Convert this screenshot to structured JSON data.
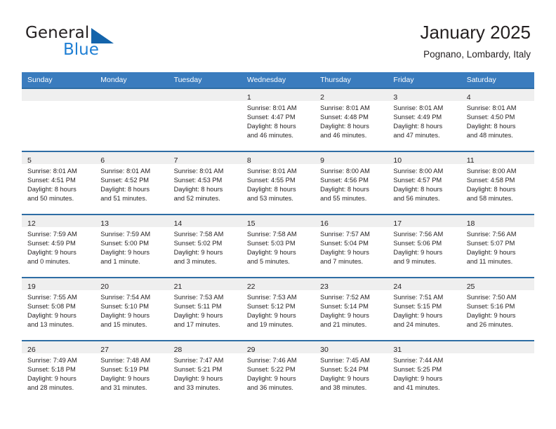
{
  "brand": {
    "name_part1": "General",
    "name_part2": "Blue",
    "logo_icon": "triangle-logo-icon"
  },
  "header": {
    "title": "January 2025",
    "subtitle": "Pognano, Lombardy, Italy"
  },
  "calendar": {
    "weekday_headers": [
      "Sunday",
      "Monday",
      "Tuesday",
      "Wednesday",
      "Thursday",
      "Friday",
      "Saturday"
    ],
    "header_bg": "#3a7cbe",
    "row_border": "#2e6da4",
    "date_band_bg": "#efefef",
    "weeks": [
      [
        {
          "empty": true
        },
        {
          "empty": true
        },
        {
          "empty": true
        },
        {
          "day": "1",
          "sunrise": "Sunrise: 8:01 AM",
          "sunset": "Sunset: 4:47 PM",
          "daylight1": "Daylight: 8 hours",
          "daylight2": "and 46 minutes."
        },
        {
          "day": "2",
          "sunrise": "Sunrise: 8:01 AM",
          "sunset": "Sunset: 4:48 PM",
          "daylight1": "Daylight: 8 hours",
          "daylight2": "and 46 minutes."
        },
        {
          "day": "3",
          "sunrise": "Sunrise: 8:01 AM",
          "sunset": "Sunset: 4:49 PM",
          "daylight1": "Daylight: 8 hours",
          "daylight2": "and 47 minutes."
        },
        {
          "day": "4",
          "sunrise": "Sunrise: 8:01 AM",
          "sunset": "Sunset: 4:50 PM",
          "daylight1": "Daylight: 8 hours",
          "daylight2": "and 48 minutes."
        }
      ],
      [
        {
          "day": "5",
          "sunrise": "Sunrise: 8:01 AM",
          "sunset": "Sunset: 4:51 PM",
          "daylight1": "Daylight: 8 hours",
          "daylight2": "and 50 minutes."
        },
        {
          "day": "6",
          "sunrise": "Sunrise: 8:01 AM",
          "sunset": "Sunset: 4:52 PM",
          "daylight1": "Daylight: 8 hours",
          "daylight2": "and 51 minutes."
        },
        {
          "day": "7",
          "sunrise": "Sunrise: 8:01 AM",
          "sunset": "Sunset: 4:53 PM",
          "daylight1": "Daylight: 8 hours",
          "daylight2": "and 52 minutes."
        },
        {
          "day": "8",
          "sunrise": "Sunrise: 8:01 AM",
          "sunset": "Sunset: 4:55 PM",
          "daylight1": "Daylight: 8 hours",
          "daylight2": "and 53 minutes."
        },
        {
          "day": "9",
          "sunrise": "Sunrise: 8:00 AM",
          "sunset": "Sunset: 4:56 PM",
          "daylight1": "Daylight: 8 hours",
          "daylight2": "and 55 minutes."
        },
        {
          "day": "10",
          "sunrise": "Sunrise: 8:00 AM",
          "sunset": "Sunset: 4:57 PM",
          "daylight1": "Daylight: 8 hours",
          "daylight2": "and 56 minutes."
        },
        {
          "day": "11",
          "sunrise": "Sunrise: 8:00 AM",
          "sunset": "Sunset: 4:58 PM",
          "daylight1": "Daylight: 8 hours",
          "daylight2": "and 58 minutes."
        }
      ],
      [
        {
          "day": "12",
          "sunrise": "Sunrise: 7:59 AM",
          "sunset": "Sunset: 4:59 PM",
          "daylight1": "Daylight: 9 hours",
          "daylight2": "and 0 minutes."
        },
        {
          "day": "13",
          "sunrise": "Sunrise: 7:59 AM",
          "sunset": "Sunset: 5:00 PM",
          "daylight1": "Daylight: 9 hours",
          "daylight2": "and 1 minute."
        },
        {
          "day": "14",
          "sunrise": "Sunrise: 7:58 AM",
          "sunset": "Sunset: 5:02 PM",
          "daylight1": "Daylight: 9 hours",
          "daylight2": "and 3 minutes."
        },
        {
          "day": "15",
          "sunrise": "Sunrise: 7:58 AM",
          "sunset": "Sunset: 5:03 PM",
          "daylight1": "Daylight: 9 hours",
          "daylight2": "and 5 minutes."
        },
        {
          "day": "16",
          "sunrise": "Sunrise: 7:57 AM",
          "sunset": "Sunset: 5:04 PM",
          "daylight1": "Daylight: 9 hours",
          "daylight2": "and 7 minutes."
        },
        {
          "day": "17",
          "sunrise": "Sunrise: 7:56 AM",
          "sunset": "Sunset: 5:06 PM",
          "daylight1": "Daylight: 9 hours",
          "daylight2": "and 9 minutes."
        },
        {
          "day": "18",
          "sunrise": "Sunrise: 7:56 AM",
          "sunset": "Sunset: 5:07 PM",
          "daylight1": "Daylight: 9 hours",
          "daylight2": "and 11 minutes."
        }
      ],
      [
        {
          "day": "19",
          "sunrise": "Sunrise: 7:55 AM",
          "sunset": "Sunset: 5:08 PM",
          "daylight1": "Daylight: 9 hours",
          "daylight2": "and 13 minutes."
        },
        {
          "day": "20",
          "sunrise": "Sunrise: 7:54 AM",
          "sunset": "Sunset: 5:10 PM",
          "daylight1": "Daylight: 9 hours",
          "daylight2": "and 15 minutes."
        },
        {
          "day": "21",
          "sunrise": "Sunrise: 7:53 AM",
          "sunset": "Sunset: 5:11 PM",
          "daylight1": "Daylight: 9 hours",
          "daylight2": "and 17 minutes."
        },
        {
          "day": "22",
          "sunrise": "Sunrise: 7:53 AM",
          "sunset": "Sunset: 5:12 PM",
          "daylight1": "Daylight: 9 hours",
          "daylight2": "and 19 minutes."
        },
        {
          "day": "23",
          "sunrise": "Sunrise: 7:52 AM",
          "sunset": "Sunset: 5:14 PM",
          "daylight1": "Daylight: 9 hours",
          "daylight2": "and 21 minutes."
        },
        {
          "day": "24",
          "sunrise": "Sunrise: 7:51 AM",
          "sunset": "Sunset: 5:15 PM",
          "daylight1": "Daylight: 9 hours",
          "daylight2": "and 24 minutes."
        },
        {
          "day": "25",
          "sunrise": "Sunrise: 7:50 AM",
          "sunset": "Sunset: 5:16 PM",
          "daylight1": "Daylight: 9 hours",
          "daylight2": "and 26 minutes."
        }
      ],
      [
        {
          "day": "26",
          "sunrise": "Sunrise: 7:49 AM",
          "sunset": "Sunset: 5:18 PM",
          "daylight1": "Daylight: 9 hours",
          "daylight2": "and 28 minutes."
        },
        {
          "day": "27",
          "sunrise": "Sunrise: 7:48 AM",
          "sunset": "Sunset: 5:19 PM",
          "daylight1": "Daylight: 9 hours",
          "daylight2": "and 31 minutes."
        },
        {
          "day": "28",
          "sunrise": "Sunrise: 7:47 AM",
          "sunset": "Sunset: 5:21 PM",
          "daylight1": "Daylight: 9 hours",
          "daylight2": "and 33 minutes."
        },
        {
          "day": "29",
          "sunrise": "Sunrise: 7:46 AM",
          "sunset": "Sunset: 5:22 PM",
          "daylight1": "Daylight: 9 hours",
          "daylight2": "and 36 minutes."
        },
        {
          "day": "30",
          "sunrise": "Sunrise: 7:45 AM",
          "sunset": "Sunset: 5:24 PM",
          "daylight1": "Daylight: 9 hours",
          "daylight2": "and 38 minutes."
        },
        {
          "day": "31",
          "sunrise": "Sunrise: 7:44 AM",
          "sunset": "Sunset: 5:25 PM",
          "daylight1": "Daylight: 9 hours",
          "daylight2": "and 41 minutes."
        },
        {
          "empty": true
        }
      ]
    ]
  }
}
